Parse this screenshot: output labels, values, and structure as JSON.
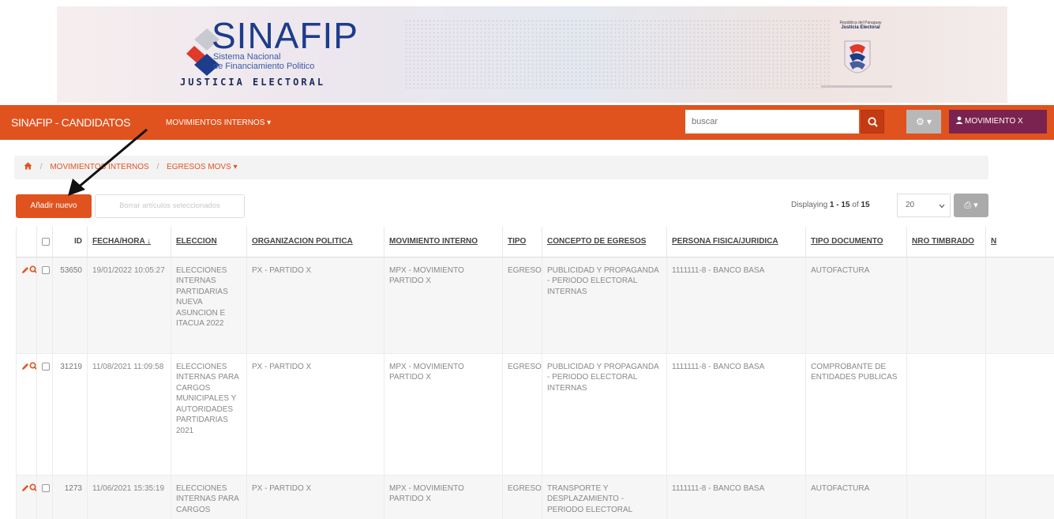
{
  "banner": {
    "logo_title": "SINAFIP",
    "logo_subtitle_1": "Sistema Nacional",
    "logo_subtitle_2": "de Financiamiento Politico",
    "logo_org": "JUSTICIA ELECTORAL",
    "seal_line_1": "República del Paraguay",
    "seal_line_2": "Justicia Electoral"
  },
  "navbar": {
    "brand": "SINAFIP - CANDIDATOS",
    "menu": "MOVIMIENTOS INTERNOS ▾",
    "search_placeholder": "buscar",
    "gear_label": "⚙ ▾",
    "user_label": "MOVIMIENTO X"
  },
  "breadcrumb": {
    "items": [
      "MOVIMIENTOS INTERNOS",
      "EGRESOS MOVS ▾"
    ]
  },
  "toolbar": {
    "add_label": "Añadir nuevo",
    "delete_label": "Borrar artículos seleccionados",
    "displaying_prefix": "Displaying ",
    "displaying_range": "1 - 15",
    "displaying_of": " of ",
    "displaying_total": "15",
    "per_page": "20",
    "print_label": "⎙ ▾"
  },
  "table": {
    "headers": [
      "ID",
      "FECHA/HORA ↓",
      "ELECCION",
      "ORGANIZACION POLITICA",
      "MOVIMIENTO INTERNO",
      "TIPO",
      "CONCEPTO DE EGRESOS",
      "PERSONA FISICA/JURIDICA",
      "TIPO DOCUMENTO",
      "NRO TIMBRADO",
      "N"
    ],
    "rows": [
      {
        "id": "53650",
        "fecha": "19/01/2022 10:05:27",
        "eleccion": "ELECCIONES INTERNAS PARTIDARIAS NUEVA ASUNCION E ITACUA 2022",
        "organizacion": "PX - PARTIDO X",
        "movimiento": "MPX - MOVIMIENTO PARTIDO X",
        "tipo": "EGRESOS",
        "concepto": "PUBLICIDAD Y PROPAGANDA - PERIODO ELECTORAL INTERNAS",
        "persona": "1111111-8 - BANCO BASA",
        "documento": "AUTOFACTURA",
        "timbrado": ""
      },
      {
        "id": "31219",
        "fecha": "11/08/2021 11:09:58",
        "eleccion": "ELECCIONES INTERNAS PARA CARGOS MUNICIPALES Y AUTORIDADES PARTIDARIAS 2021",
        "organizacion": "PX - PARTIDO X",
        "movimiento": "MPX - MOVIMIENTO PARTIDO X",
        "tipo": "EGRESOS",
        "concepto": "PUBLICIDAD Y PROPAGANDA - PERIODO ELECTORAL INTERNAS",
        "persona": "1111111-8 - BANCO BASA",
        "documento": "COMPROBANTE DE ENTIDADES PUBLICAS",
        "timbrado": ""
      },
      {
        "id": "1273",
        "fecha": "11/06/2021 15:35:19",
        "eleccion": "ELECCIONES INTERNAS PARA CARGOS",
        "organizacion": "PX - PARTIDO X",
        "movimiento": "MPX - MOVIMIENTO PARTIDO X",
        "tipo": "EGRESOS",
        "concepto": "TRANSPORTE Y DESPLAZAMIENTO - PERIODO ELECTORAL",
        "persona": "1111111-8 - BANCO BASA",
        "documento": "AUTOFACTURA",
        "timbrado": ""
      }
    ]
  },
  "colors": {
    "accent": "#e0531f",
    "user_button": "#7a2350",
    "search_button": "#c43a12"
  }
}
